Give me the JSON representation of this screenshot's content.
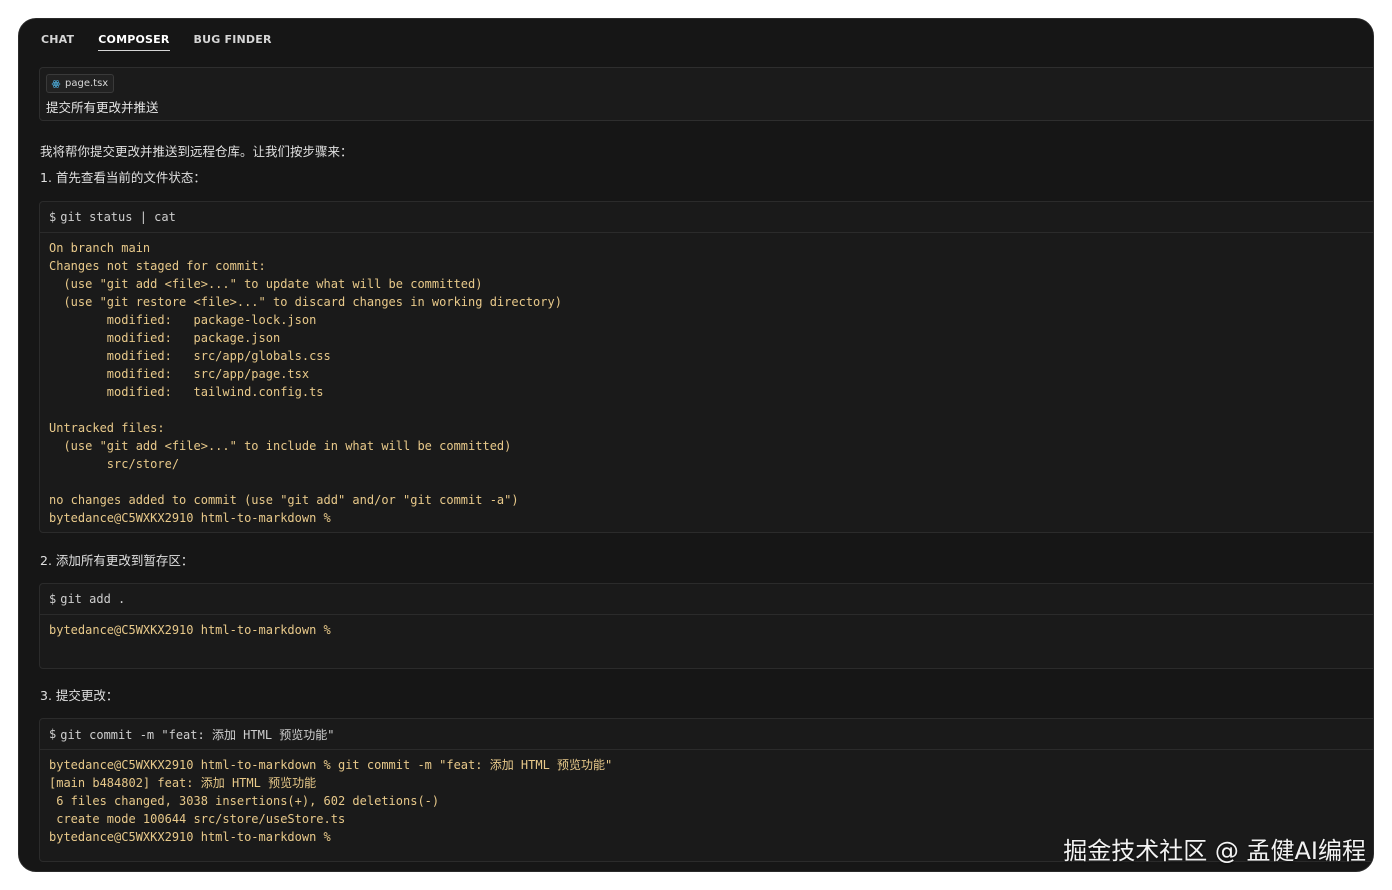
{
  "tabs": [
    {
      "label": "CHAT"
    },
    {
      "label": "COMPOSER"
    },
    {
      "label": "BUG FINDER"
    }
  ],
  "prompt": {
    "file_chip": "page.tsx",
    "file_icon": "react-icon",
    "text": "提交所有更改并推送"
  },
  "messages": {
    "intro": "我将帮你提交更改并推送到远程仓库。让我们按步骤来：",
    "step1": "1. 首先查看当前的文件状态：",
    "step2": "2. 添加所有更改到暂存区：",
    "step3": "3. 提交更改："
  },
  "blocks": [
    {
      "command": "git status | cat",
      "output": [
        "On branch main",
        "Changes not staged for commit:",
        "  (use \"git add <file>...\" to update what will be committed)",
        "  (use \"git restore <file>...\" to discard changes in working directory)",
        "        modified:   package-lock.json",
        "        modified:   package.json",
        "        modified:   src/app/globals.css",
        "        modified:   src/app/page.tsx",
        "        modified:   tailwind.config.ts",
        "",
        "Untracked files:",
        "  (use \"git add <file>...\" to include in what will be committed)",
        "        src/store/",
        "",
        "no changes added to commit (use \"git add\" and/or \"git commit -a\")",
        "bytedance@C5WXKX2910 html-to-markdown %"
      ]
    },
    {
      "command": "git add .",
      "output": [
        "bytedance@C5WXKX2910 html-to-markdown %"
      ]
    },
    {
      "command": "git commit -m \"feat: 添加 HTML 预览功能\"",
      "output": [
        "bytedance@C5WXKX2910 html-to-markdown % git commit -m \"feat: 添加 HTML 预览功能\"",
        "[main b484802] feat: 添加 HTML 预览功能",
        " 6 files changed, 3038 insertions(+), 602 deletions(-)",
        " create mode 100644 src/store/useStore.ts",
        "bytedance@C5WXKX2910 html-to-markdown %"
      ]
    }
  ],
  "dollar": "$",
  "watermark": "掘金技术社区 @ 孟健AI编程",
  "colors": {
    "background": "#161616",
    "terminal_text": "#e8c98a",
    "text": "#e0e0e0"
  }
}
